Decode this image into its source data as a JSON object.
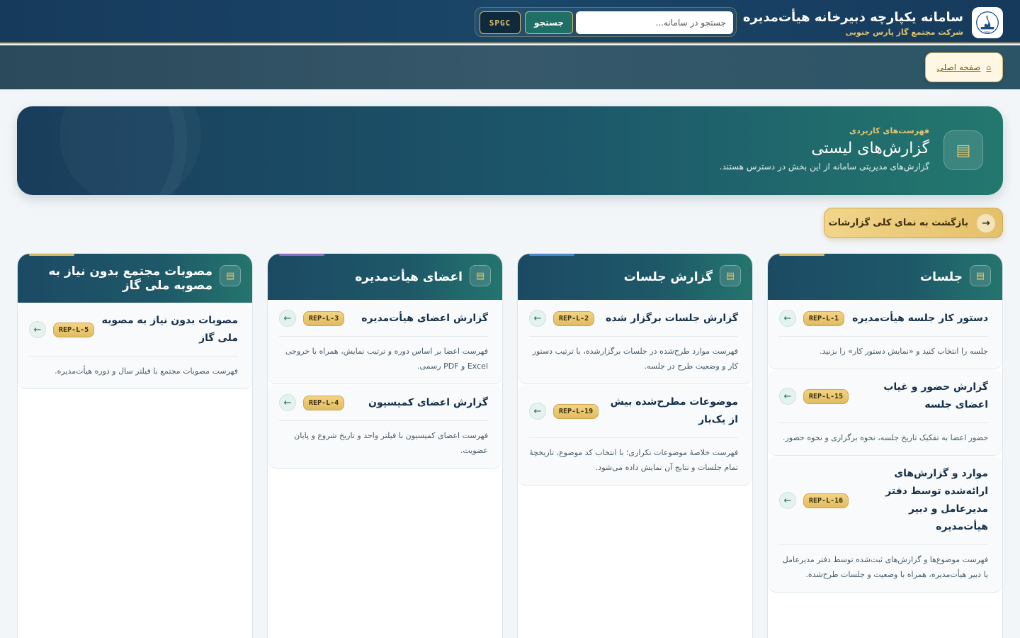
{
  "header": {
    "title": "سامانه یکپارچه دبیرخانه هیأت‌مدیره",
    "subtitle": "شرکت مجتمع گاز پارس جنوبی",
    "search_placeholder": "جستجو در سامانه...",
    "search_button": "جستجو",
    "org_button": "SPGC"
  },
  "nav": {
    "home_label": "صفحه اصلی",
    "home_icon": "⌂"
  },
  "hero": {
    "kicker": "فهرست‌های کاربردی",
    "title": "گزارش‌های لیستی",
    "description": "گزارش‌های مدیریتی سامانه از این بخش در دسترس هستند.",
    "icon": "list-icon"
  },
  "back_button": {
    "label": "بازگشت به نمای کلی گزارشات",
    "arrow": "→"
  },
  "colors": {
    "header_bg": "#163a5c",
    "gold": "#d6b665",
    "teal": "#1f6f66"
  },
  "columns": [
    {
      "title": "جلسات",
      "accent": "#d6b665",
      "cards": [
        {
          "code": "REP-L-1",
          "title": "دستور کار جلسه هیأت‌مدیره",
          "desc": "جلسه را انتخاب کنید و «نمایش دستور کار» را بزنید."
        },
        {
          "code": "REP-L-15",
          "title": "گزارش حضور و غیاب اعضای جلسه",
          "desc": "حضور اعضا به تفکیک تاریخ جلسه، نحوه برگزاری و نحوه حضور."
        },
        {
          "code": "REP-L-16",
          "title": "موارد و گزارش‌های ارائه‌شده توسط دفتر مدیرعامل و دبیر هیأت‌مدیره",
          "desc": "فهرست موضوع‌ها و گزارش‌های ثبت‌شده توسط دفتر مدیرعامل یا دبیر هیأت‌مدیره، همراه با وضعیت و جلسات طرح‌شده."
        }
      ]
    },
    {
      "title": "گزارش جلسات",
      "accent": "#4a86c7",
      "cards": [
        {
          "code": "REP-L-2",
          "title": "گزارش جلسات برگزار شده",
          "desc": "فهرست موارد طرح‌شده در جلسات برگزارشده، با ترتیب دستور کار و وضعیت طرح در جلسه."
        },
        {
          "code": "REP-L-19",
          "title": "موضوعات مطرح‌شده بیش از یک‌بار",
          "desc": "فهرست خلاصهٔ موضوعات تکراری؛ با انتخاب کد موضوع، تاریخچهٔ تمام جلسات و نتایج آن نمایش داده می‌شود."
        }
      ]
    },
    {
      "title": "اعضای هیأت‌مدیره",
      "accent": "#8a6fc0",
      "cards": [
        {
          "code": "REP-L-3",
          "title": "گزارش اعضای هیأت‌مدیره",
          "desc": "فهرست اعضا بر اساس دوره و ترتیب نمایش، همراه با خروجی Excel و PDF رسمی."
        },
        {
          "code": "REP-L-4",
          "title": "گزارش اعضای کمیسیون",
          "desc": "فهرست اعضای کمیسیون با فیلتر واحد و تاریخ شروع و پایان عضویت."
        }
      ]
    },
    {
      "title": "مصوبات مجتمع بدون نیاز به مصوبه ملی گاز",
      "accent": "#d6b665",
      "cards": [
        {
          "code": "REP-L-5",
          "title": "مصوبات بدون نیاز به مصوبه ملی گاز",
          "desc": "فهرست مصوبات مجتمع با فیلتر سال و دوره هیأت‌مدیره."
        }
      ]
    }
  ]
}
